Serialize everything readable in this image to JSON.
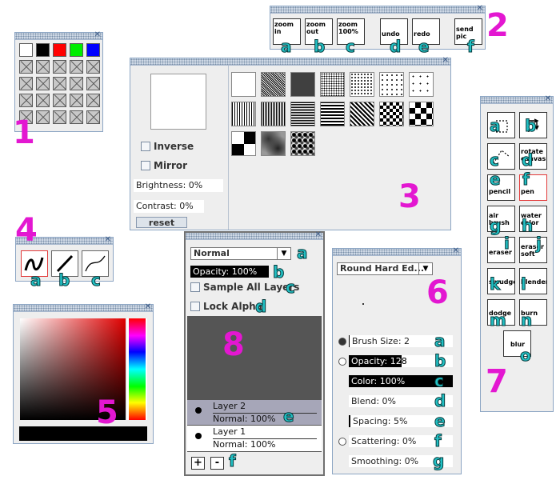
{
  "labels": {
    "n1": "1",
    "n2": "2",
    "n3": "3",
    "n4": "4",
    "n5": "5",
    "n6": "6",
    "n7": "7",
    "n8": "8",
    "a": "a",
    "b": "b",
    "c": "c",
    "d": "d",
    "e": "e",
    "f": "f",
    "g": "g",
    "h": "h",
    "i": "i",
    "j": "j",
    "k": "k",
    "l": "l",
    "m": "m",
    "n": "n",
    "o": "o"
  },
  "palette": {
    "colors": [
      "#ffffff",
      "#000000",
      "#ff0000",
      "#00ee00",
      "#0000ff"
    ],
    "empty_slots": 20
  },
  "toolbar2": {
    "zoom_in": "zoom in",
    "zoom_out": "zoom out",
    "zoom_100": "zoom 100%",
    "undo": "undo",
    "redo": "redo",
    "send_pic": "send pic"
  },
  "texture": {
    "inverse": "Inverse",
    "mirror": "Mirror",
    "brightness": "Brightness: 0%",
    "contrast": "Contrast: 0%",
    "reset": "reset"
  },
  "strokes": [
    "freehand",
    "line",
    "bezier"
  ],
  "layers": {
    "blend_mode": "Normal",
    "opacity": "Opacity: 100%",
    "sample_all": "Sample All Layers",
    "lock_alpha": "Lock Alpha",
    "items": [
      {
        "name": "Layer 2",
        "mode": "Normal: 100%"
      },
      {
        "name": "Layer 1",
        "mode": "Normal: 100%"
      }
    ],
    "add": "+",
    "remove": "-"
  },
  "brush": {
    "tip": "Round Hard Ed...",
    "size": "Brush Size: 2",
    "opacity": "Opacity: 128",
    "color": "Color: 100%",
    "blend": "Blend: 0%",
    "spacing": "Spacing: 5%",
    "scattering": "Scattering: 0%",
    "smoothing": "Smoothing: 0%"
  },
  "tools": {
    "pencil": "pencil",
    "pen": "pen",
    "airbrush": "air brush",
    "watercolor": "water color",
    "eraser": "eraser",
    "softeraser": "eraser soft",
    "smudge": "smudge",
    "blender": "blender",
    "dodge": "dodge",
    "burn": "burn",
    "blur": "blur",
    "rotate": "rotate canvas"
  }
}
